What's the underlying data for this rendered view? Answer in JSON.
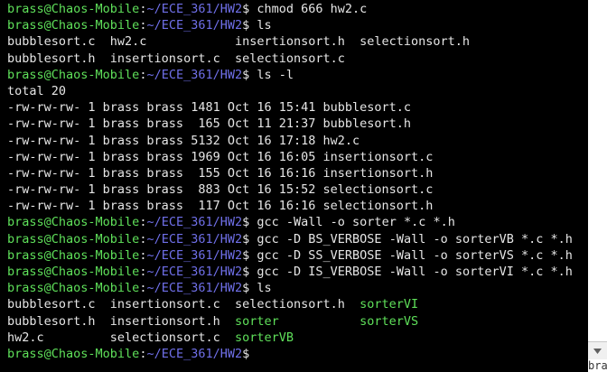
{
  "prompt": {
    "user_host": "brass@Chaos-Mobile",
    "separator": ":",
    "path": "~/ECE_361/HW2",
    "symbol": "$"
  },
  "lines": [
    {
      "type": "prompt",
      "command": " chmod 666 hw2.c"
    },
    {
      "type": "prompt",
      "command": " ls"
    },
    {
      "type": "output",
      "text": "bubblesort.c  hw2.c            insertionsort.h  selectionsort.h"
    },
    {
      "type": "output",
      "text": "bubblesort.h  insertionsort.c  selectionsort.c"
    },
    {
      "type": "prompt",
      "command": " ls -l"
    },
    {
      "type": "output",
      "text": "total 20"
    },
    {
      "type": "output",
      "text": "-rw-rw-rw- 1 brass brass 1481 Oct 16 15:41 bubblesort.c"
    },
    {
      "type": "output",
      "text": "-rw-rw-rw- 1 brass brass  165 Oct 11 21:37 bubblesort.h"
    },
    {
      "type": "output",
      "text": "-rw-rw-rw- 1 brass brass 5132 Oct 16 17:18 hw2.c"
    },
    {
      "type": "output",
      "text": "-rw-rw-rw- 1 brass brass 1969 Oct 16 16:05 insertionsort.c"
    },
    {
      "type": "output",
      "text": "-rw-rw-rw- 1 brass brass  155 Oct 16 16:16 insertionsort.h"
    },
    {
      "type": "output",
      "text": "-rw-rw-rw- 1 brass brass  883 Oct 16 15:52 selectionsort.c"
    },
    {
      "type": "output",
      "text": "-rw-rw-rw- 1 brass brass  117 Oct 16 16:16 selectionsort.h"
    },
    {
      "type": "prompt",
      "command": " gcc -Wall -o sorter *.c *.h"
    },
    {
      "type": "prompt",
      "command": " gcc -D BS_VERBOSE -Wall -o sorterVB *.c *.h"
    },
    {
      "type": "prompt",
      "command": " gcc -D SS_VERBOSE -Wall -o sorterVS *.c *.h"
    },
    {
      "type": "prompt",
      "command": " gcc -D IS_VERBOSE -Wall -o sorterVI *.c *.h"
    },
    {
      "type": "prompt",
      "command": " ls"
    },
    {
      "type": "listing",
      "segments": [
        {
          "text": "bubblesort.c  insertionsort.c  selectionsort.h  ",
          "exec": false
        },
        {
          "text": "sorterVI",
          "exec": true
        }
      ]
    },
    {
      "type": "listing",
      "segments": [
        {
          "text": "bubblesort.h  insertionsort.h  ",
          "exec": false
        },
        {
          "text": "sorter",
          "exec": true
        },
        {
          "text": "           ",
          "exec": false
        },
        {
          "text": "sorterVS",
          "exec": true
        }
      ]
    },
    {
      "type": "listing",
      "segments": [
        {
          "text": "hw2.c         selectionsort.c  ",
          "exec": false
        },
        {
          "text": "sorterVB",
          "exec": true
        }
      ]
    },
    {
      "type": "prompt",
      "command": ""
    }
  ],
  "scrollbar": {
    "peek_text": "bra"
  }
}
